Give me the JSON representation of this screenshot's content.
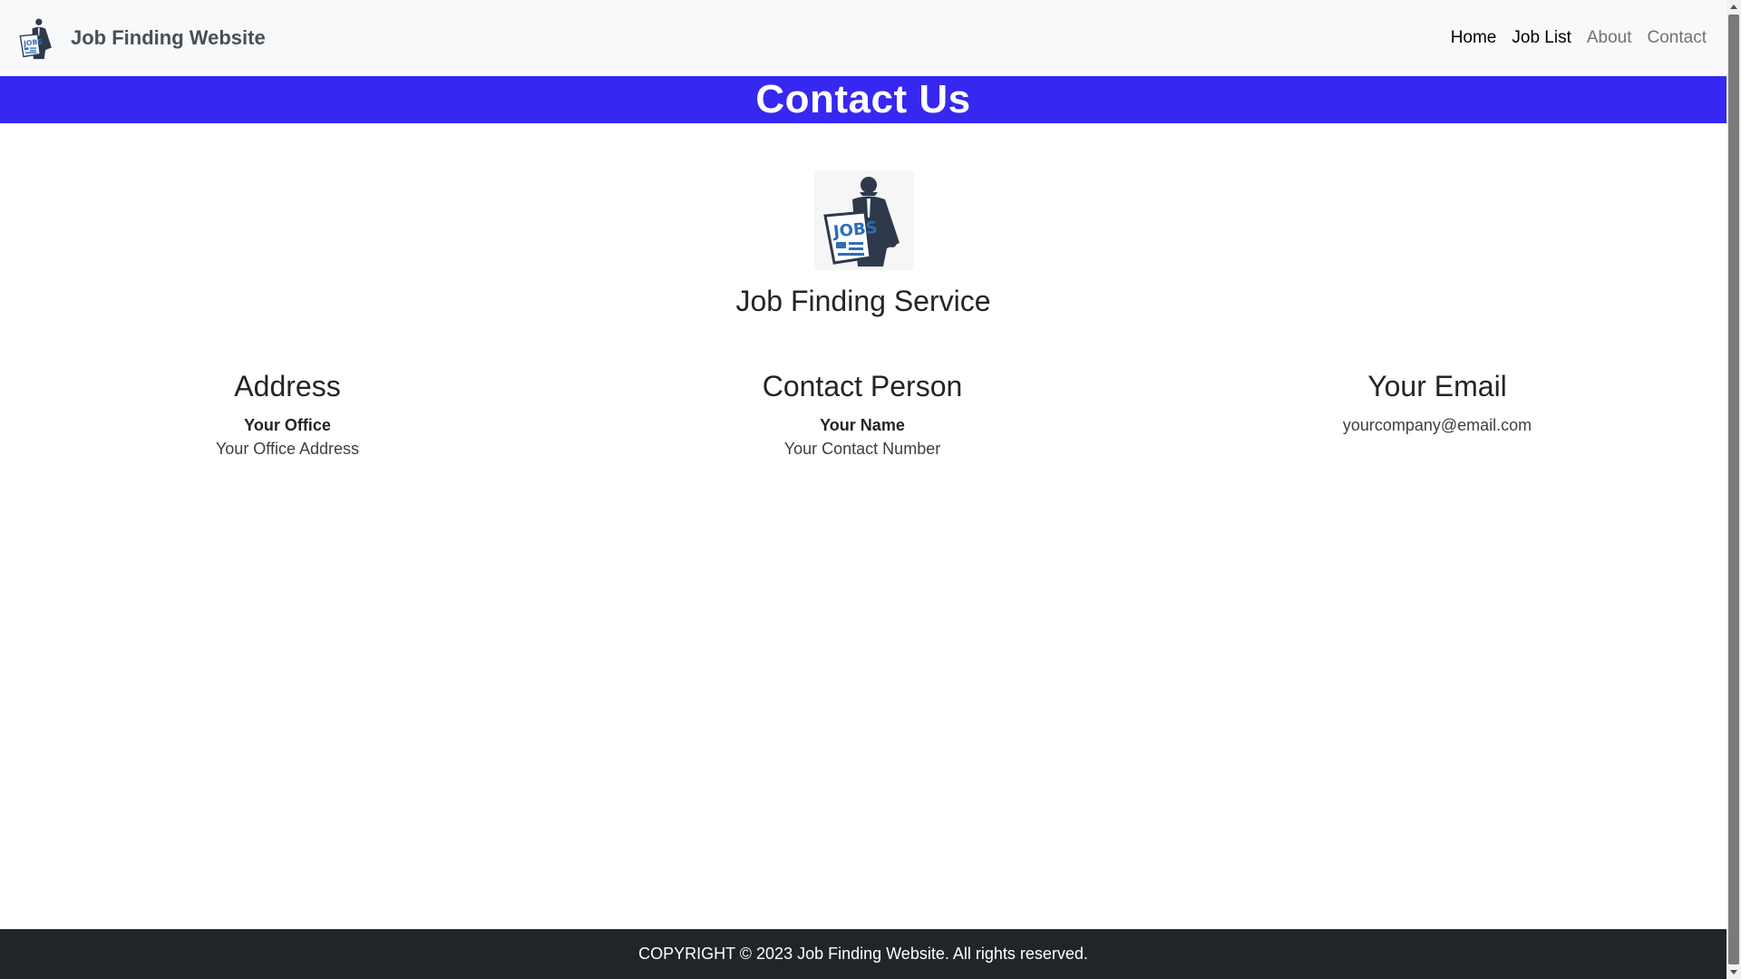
{
  "navbar": {
    "brand": "Job Finding Website",
    "links": [
      {
        "label": "Home",
        "active": true
      },
      {
        "label": "Job List",
        "active": true
      },
      {
        "label": "About",
        "active": false
      },
      {
        "label": "Contact",
        "active": false
      }
    ]
  },
  "banner": {
    "title": "Contact Us",
    "color": "#3628f0"
  },
  "service": {
    "title": "Job Finding Service",
    "logo_icon": "jobs-newspaper-man-icon",
    "logo_text": "JOBS"
  },
  "columns": {
    "address": {
      "heading": "Address",
      "name": "Your Office",
      "detail": "Your Office Address"
    },
    "contact": {
      "heading": "Contact Person",
      "name": "Your Name",
      "detail": "Your Contact Number"
    },
    "email": {
      "heading": "Your Email",
      "value": "yourcompany@email.com"
    }
  },
  "footer": {
    "text": "COPYRIGHT © 2023 Job Finding Website. All rights reserved."
  }
}
